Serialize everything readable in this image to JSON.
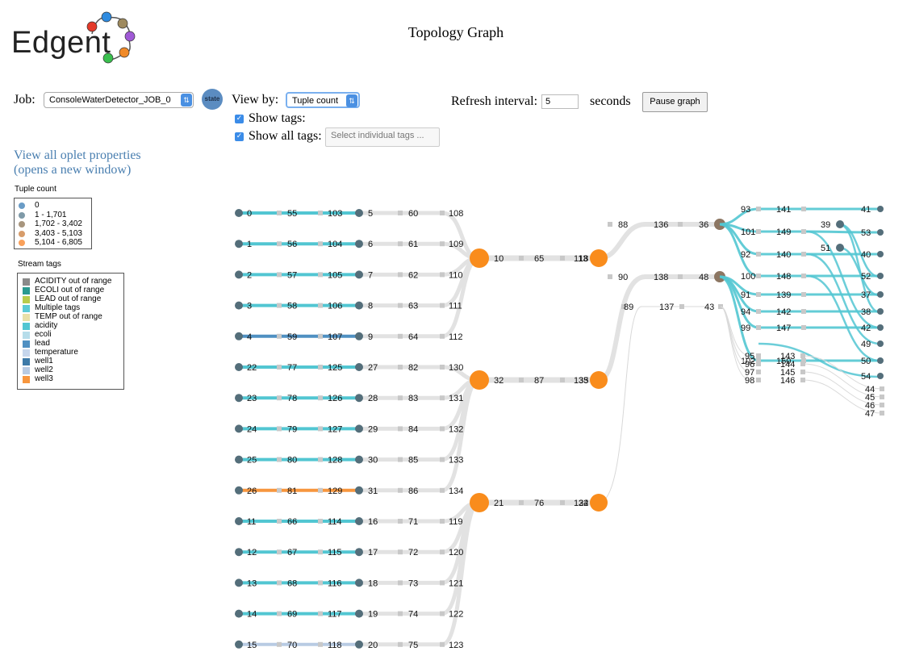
{
  "logo": {
    "text": "Edgent"
  },
  "page_title": "Topology Graph",
  "job": {
    "label": "Job:",
    "value": "ConsoleWaterDetector_JOB_0",
    "state_label": "state"
  },
  "view_by": {
    "label": "View by:",
    "value": "Tuple count"
  },
  "show_tags": {
    "label": "Show tags:",
    "checked": true
  },
  "show_all_tags": {
    "label": "Show all tags:",
    "checked": true,
    "placeholder": "Select individual tags ..."
  },
  "refresh": {
    "label": "Refresh interval:",
    "value": "5",
    "unit": "seconds"
  },
  "pause_button": "Pause graph",
  "oplet_link": {
    "line1": "View all oplet properties",
    "line2": "(opens a new window)"
  },
  "tuple_legend": {
    "title": "Tuple count",
    "items": [
      {
        "label": "0",
        "color": "#6a9cc6"
      },
      {
        "label": "1 - 1,701",
        "color": "#7f9aa8"
      },
      {
        "label": "1,702 - 3,402",
        "color": "#a8967e"
      },
      {
        "label": "3,403 - 5,103",
        "color": "#d79c6a"
      },
      {
        "label": "5,104 - 6,805",
        "color": "#f9a05a"
      }
    ]
  },
  "stream_legend": {
    "title": "Stream tags",
    "items": [
      {
        "label": "ACIDITY out of range",
        "color": "#8a8a8a"
      },
      {
        "label": "ECOLI out of range",
        "color": "#2a9a90"
      },
      {
        "label": "LEAD out of range",
        "color": "#b9cc4c"
      },
      {
        "label": "Multiple tags",
        "color": "#5ccad6"
      },
      {
        "label": "TEMP out of range",
        "color": "#e8e0a8"
      },
      {
        "label": "acidity",
        "color": "#52c6d2"
      },
      {
        "label": "ecoli",
        "color": "#b6ddea"
      },
      {
        "label": "lead",
        "color": "#4f90c2"
      },
      {
        "label": "temperature",
        "color": "#c6d6ec"
      },
      {
        "label": "well1",
        "color": "#3d7aa8"
      },
      {
        "label": "well2",
        "color": "#b8cbe3"
      },
      {
        "label": "well3",
        "color": "#f7963e"
      }
    ]
  },
  "graph": {
    "source_rows": [
      {
        "ids": [
          "0",
          "55",
          "103",
          "5",
          "60",
          "108"
        ],
        "tag": "acidity",
        "merge": 0
      },
      {
        "ids": [
          "1",
          "56",
          "104",
          "6",
          "61",
          "109"
        ],
        "tag": "acidity",
        "merge": 0
      },
      {
        "ids": [
          "2",
          "57",
          "105",
          "7",
          "62",
          "110"
        ],
        "tag": "acidity",
        "merge": 0
      },
      {
        "ids": [
          "3",
          "58",
          "106",
          "8",
          "63",
          "111"
        ],
        "tag": "acidity",
        "merge": 0
      },
      {
        "ids": [
          "4",
          "59",
          "107",
          "9",
          "64",
          "112"
        ],
        "tag": "lead",
        "merge": 0
      },
      {
        "ids": [
          "22",
          "77",
          "125",
          "27",
          "82",
          "130"
        ],
        "tag": "acidity",
        "merge": 1
      },
      {
        "ids": [
          "23",
          "78",
          "126",
          "28",
          "83",
          "131"
        ],
        "tag": "acidity",
        "merge": 1
      },
      {
        "ids": [
          "24",
          "79",
          "127",
          "29",
          "84",
          "132"
        ],
        "tag": "acidity",
        "merge": 1
      },
      {
        "ids": [
          "25",
          "80",
          "128",
          "30",
          "85",
          "133"
        ],
        "tag": "acidity",
        "merge": 1
      },
      {
        "ids": [
          "26",
          "81",
          "129",
          "31",
          "86",
          "134"
        ],
        "tag": "well3",
        "merge": 1
      },
      {
        "ids": [
          "11",
          "66",
          "114",
          "16",
          "71",
          "119"
        ],
        "tag": "acidity",
        "merge": 2
      },
      {
        "ids": [
          "12",
          "67",
          "115",
          "17",
          "72",
          "120"
        ],
        "tag": "acidity",
        "merge": 2
      },
      {
        "ids": [
          "13",
          "68",
          "116",
          "18",
          "73",
          "121"
        ],
        "tag": "acidity",
        "merge": 2
      },
      {
        "ids": [
          "14",
          "69",
          "117",
          "19",
          "74",
          "122"
        ],
        "tag": "acidity",
        "merge": 2
      },
      {
        "ids": [
          "15",
          "70",
          "118",
          "20",
          "75",
          "123"
        ],
        "tag": "well2",
        "merge": 2
      }
    ],
    "merge_rows": [
      {
        "ids": [
          "10",
          "65",
          "113",
          "18"
        ]
      },
      {
        "ids": [
          "32",
          "87",
          "135",
          "33"
        ]
      },
      {
        "ids": [
          "21",
          "76",
          "124",
          "32"
        ]
      }
    ],
    "split_rows": [
      {
        "ids": [
          "88",
          "136",
          "36"
        ]
      },
      {
        "ids": [
          "90",
          "138",
          "48"
        ]
      },
      {
        "ids": [
          "89",
          "137",
          "43"
        ]
      }
    ],
    "fan_rows": [
      {
        "ids": [
          "93",
          "141",
          "41"
        ]
      },
      {
        "ids": [
          "101",
          "149",
          "53"
        ],
        "mid": "39"
      },
      {
        "ids": [
          "92",
          "140",
          "40"
        ],
        "mid": "51"
      },
      {
        "ids": [
          "100",
          "148",
          "52"
        ]
      },
      {
        "ids": [
          "91",
          "139",
          "37"
        ]
      },
      {
        "ids": [
          "94",
          "142",
          "38"
        ]
      },
      {
        "ids": [
          "99",
          "147",
          "42"
        ]
      },
      {
        "ids": [
          "",
          "",
          "49"
        ]
      },
      {
        "ids": [
          "102",
          "150",
          "50"
        ]
      },
      {
        "ids": [
          "",
          "",
          "54"
        ]
      }
    ],
    "small_rows": [
      {
        "ids": [
          "95",
          "143"
        ]
      },
      {
        "ids": [
          "96",
          "144"
        ]
      },
      {
        "ids": [
          "97",
          "145"
        ]
      },
      {
        "ids": [
          "98",
          "146"
        ]
      }
    ],
    "tail_ids": [
      "44",
      "45",
      "46",
      "47"
    ]
  }
}
